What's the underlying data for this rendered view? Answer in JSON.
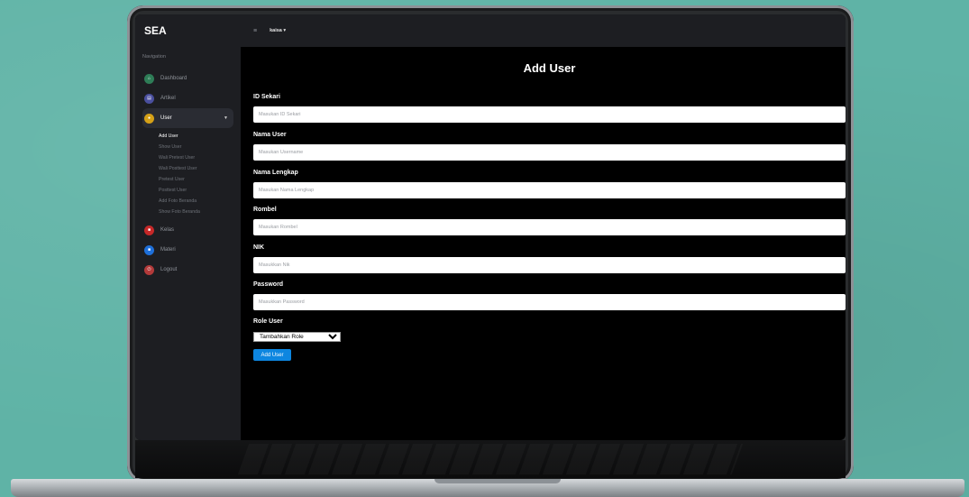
{
  "app": {
    "brand": "SEA"
  },
  "topbar": {
    "menu_icon": "hamburger-icon",
    "user": "kaisa ▾"
  },
  "sidebar": {
    "section_title": "Navigation",
    "items": [
      {
        "label": "Dashboard",
        "icon": "home-icon",
        "color": "#2e7d57"
      },
      {
        "label": "Artikel",
        "icon": "article-icon",
        "color": "#4a4f9e"
      },
      {
        "label": "User",
        "icon": "user-icon",
        "color": "#d4a017",
        "active": true
      },
      {
        "label": "Kelas",
        "icon": "class-icon",
        "color": "#c62828"
      },
      {
        "label": "Materi",
        "icon": "book-icon",
        "color": "#1e6fd9"
      },
      {
        "label": "Logout",
        "icon": "logout-icon",
        "color": "#b33a3a"
      }
    ],
    "user_submenu": [
      "Add User",
      "Show User",
      "Wali Pretest User",
      "Wali Posttest User",
      "Pretest User",
      "Posttest User",
      "Add Foto Beranda",
      "Show Foto Beranda"
    ]
  },
  "form": {
    "title": "Add User",
    "fields": [
      {
        "label": "ID Sekari",
        "placeholder": "Masukan ID Sekari"
      },
      {
        "label": "Nama User",
        "placeholder": "Masukan Username"
      },
      {
        "label": "Nama Lengkap",
        "placeholder": "Masukan Nama Lengkap"
      },
      {
        "label": "Rombel",
        "placeholder": "Masukan Rombel"
      },
      {
        "label": "NIK",
        "placeholder": "Masukkan Nik"
      },
      {
        "label": "Password",
        "placeholder": "Masukkan Password"
      }
    ],
    "role_label": "Role User",
    "role_selected": "Tambahkan Role",
    "submit_label": "Add User"
  },
  "colors": {
    "accent": "#0d86e0",
    "sidebar_bg": "#1d1e22",
    "screen_bg": "#000000",
    "wall": "#5fb3a6"
  }
}
